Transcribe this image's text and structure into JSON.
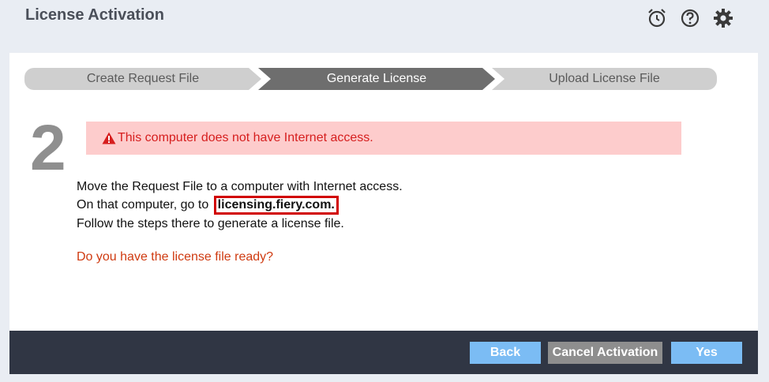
{
  "app": {
    "title": "License Activation"
  },
  "header_icons": [
    "alarm-icon",
    "help-icon",
    "gear-icon"
  ],
  "steps": [
    {
      "label": "Create Request File",
      "state": "done"
    },
    {
      "label": "Generate License",
      "state": "active"
    },
    {
      "label": "Upload License File",
      "state": "pending"
    }
  ],
  "step_number": "2",
  "alert": {
    "text": "This computer does not have Internet access.",
    "icon": "warning-icon",
    "color": "#d61e1e"
  },
  "instructions": {
    "line1": "Move the Request File to a computer with Internet access.",
    "line2_prefix": "On that computer, go to",
    "link": "licensing.fiery.com.",
    "line3": "Follow the steps there to generate a license file."
  },
  "question": "Do you have the license file ready?",
  "buttons": {
    "back": "Back",
    "cancel": "Cancel Activation",
    "yes": "Yes"
  },
  "colors": {
    "accent": "#7bbcf4",
    "footer": "#303644",
    "alert_bg": "#fdcccc"
  }
}
